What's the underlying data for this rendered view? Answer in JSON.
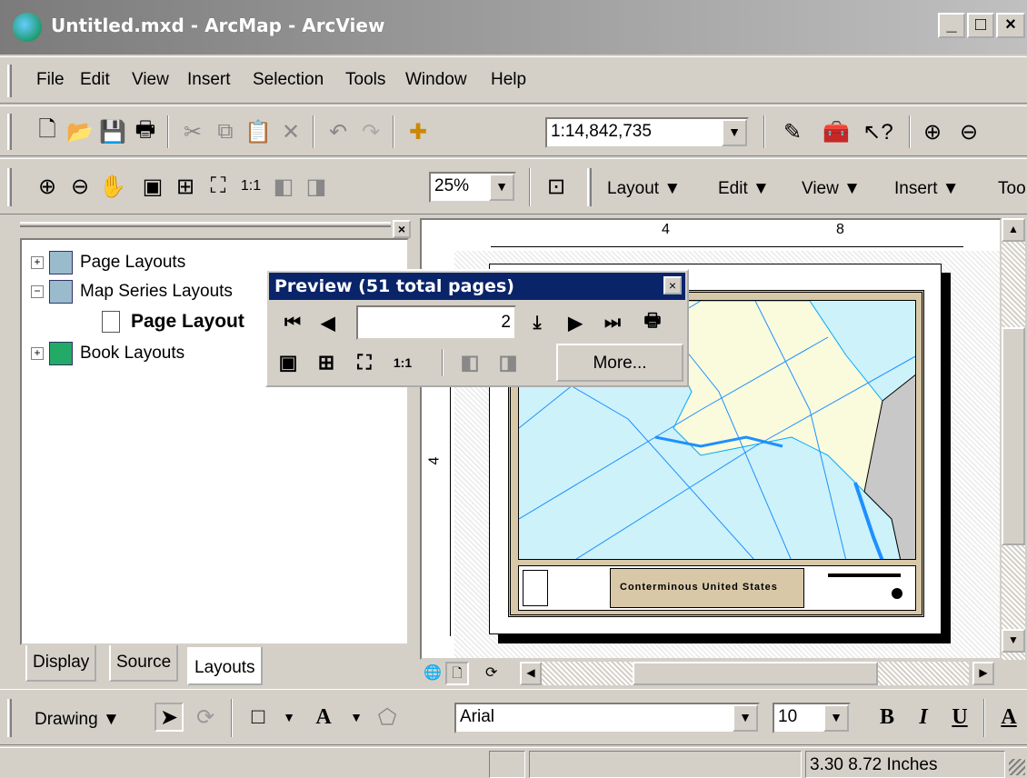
{
  "window": {
    "title": "Untitled.mxd - ArcMap - ArcView",
    "min": "_",
    "max": "□",
    "close": "×"
  },
  "menu": [
    "File",
    "Edit",
    "View",
    "Insert",
    "Selection",
    "Tools",
    "Window",
    "Help"
  ],
  "standard_toolbar": {
    "scale": "1:14,842,735"
  },
  "layout_toolbar": {
    "zoom": "25%",
    "menus": [
      "Layout ▼",
      "Edit ▼",
      "View ▼",
      "Insert ▼",
      "Too"
    ]
  },
  "toc": {
    "items": [
      "Page Layouts",
      "Map Series Layouts",
      "Page Layout",
      "Book Layouts"
    ],
    "tabs": [
      "Display",
      "Source",
      "Layouts"
    ]
  },
  "preview": {
    "title": "Preview (51 total pages)",
    "page": "2",
    "more": "More..."
  },
  "ruler": {
    "h": [
      "4",
      "8"
    ],
    "v": "4"
  },
  "map": {
    "title": "Conterminous United States"
  },
  "drawing": {
    "label": "Drawing ▼",
    "font": "Arial",
    "size": "10",
    "bold": "B",
    "italic": "I",
    "underline": "U"
  },
  "status": {
    "coords": "3.30  8.72 Inches"
  }
}
